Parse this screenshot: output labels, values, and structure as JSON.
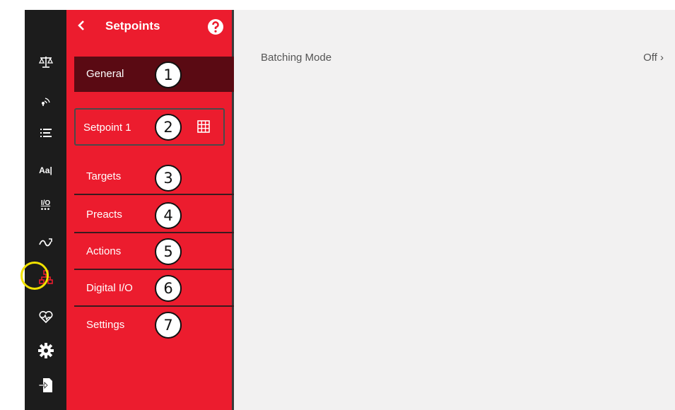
{
  "menu": {
    "title": "Setpoints",
    "items": [
      {
        "label": "General",
        "callout": "1"
      },
      {
        "label": "Setpoint 1",
        "callout": "2"
      },
      {
        "label": "Targets",
        "callout": "3"
      },
      {
        "label": "Preacts",
        "callout": "4"
      },
      {
        "label": "Actions",
        "callout": "5"
      },
      {
        "label": "Digital I/O",
        "callout": "6"
      },
      {
        "label": "Settings",
        "callout": "7"
      }
    ]
  },
  "rail": {
    "text_icon": "Aa|",
    "io_icon": "I/O",
    "icons": [
      "scale-icon",
      "signal-icon",
      "list-icon",
      "text-format-icon",
      "io-icon",
      "flow-icon",
      "hierarchy-icon",
      "heartbeat-icon",
      "gear-icon",
      "export-icon"
    ],
    "highlight_color": "#f2e200"
  },
  "main": {
    "row_label": "Batching Mode",
    "row_value": "Off ›"
  },
  "colors": {
    "accent": "#ec1c2e",
    "selected": "#5a0a13",
    "rail": "#1c1c1c"
  }
}
